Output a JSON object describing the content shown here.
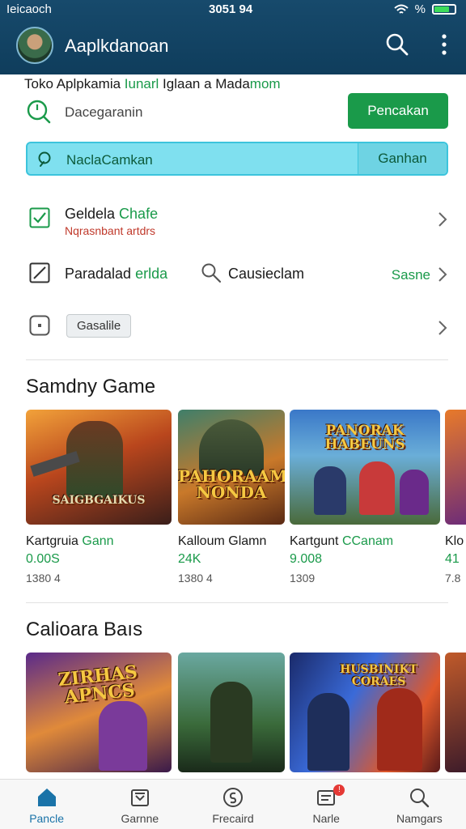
{
  "status": {
    "carrier": "Ieicaoch",
    "time": "3051 94",
    "battery_level": 0.75,
    "battery_text": "%"
  },
  "appbar": {
    "title": "Aaplkdanoan",
    "search_icon": "search-icon",
    "menu_icon": "more-vert-icon"
  },
  "headline": {
    "part1": "Toko Aplpkamia ",
    "part2": "Iunarl",
    " part3": " Iglaan a Mada",
    "part4": "mom"
  },
  "search_row": {
    "text": "Dacegaranin",
    "button": "Pencakan"
  },
  "search_bar": {
    "placeholder": "NaclaCamkan",
    "button": "Ganhan"
  },
  "rows": {
    "row1": {
      "title_a": "Geldela ",
      "title_b": "Chafe",
      "subtitle": "Nqrasnbant artdrs"
    },
    "row2": {
      "title_a": "Paradalad ",
      "title_b": "erlda",
      "search_text": "Causieclam",
      "link": "Sasne"
    },
    "row3": {
      "chip": "Gasalile"
    }
  },
  "section1": {
    "title": "Samdny Game",
    "cards": [
      {
        "name_a": "Kartgruia ",
        "name_b": "Gann",
        "price": "0.00S",
        "meta": "1380 4",
        "art": "SAIGBGAIKUS"
      },
      {
        "name_a": "Kalloum Glamn",
        "name_b": "",
        "price": "24K",
        "meta": "1380 4",
        "art": "PAHORAAM NONDA"
      },
      {
        "name_a": "Kartgunt ",
        "name_b": "CCanam",
        "price": "9.008",
        "meta": "1309",
        "art": "PANORAK HABEUNS"
      },
      {
        "name_a": "Klo",
        "name_b": "",
        "price": "41",
        "meta": "7.8",
        "art": ""
      }
    ]
  },
  "section2": {
    "title": "Calioara Baıs",
    "cards": [
      {
        "art": "ZIRHAS APNCS"
      },
      {
        "art": ""
      },
      {
        "art": "HUSBINIKT CORAES"
      },
      {
        "art": ""
      }
    ]
  },
  "nav": [
    {
      "label": "Pancle",
      "icon": "home-icon",
      "active": true
    },
    {
      "label": "Garnne",
      "icon": "game-box-icon",
      "active": false
    },
    {
      "label": "Frecaird",
      "icon": "dollar-circle-icon",
      "active": false
    },
    {
      "label": "Narle",
      "icon": "inbox-icon",
      "active": false,
      "badge": "!"
    },
    {
      "label": "Namgars",
      "icon": "search-icon",
      "active": false
    }
  ],
  "colors": {
    "accent": "#1a9a4a",
    "header": "#174a6c",
    "search_bar": "#7fe0ef"
  }
}
